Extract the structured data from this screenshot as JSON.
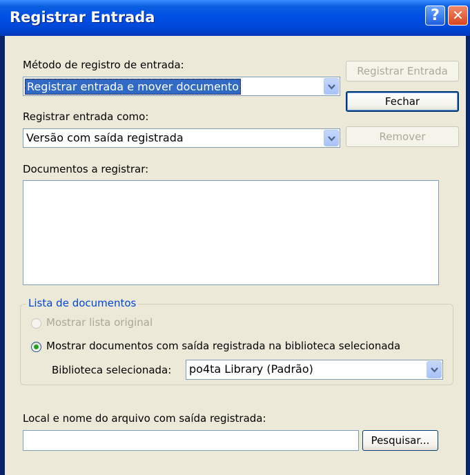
{
  "window": {
    "title": "Registrar Entrada",
    "help_label": "?",
    "close_label": "✕"
  },
  "method": {
    "label": "Método de registro de entrada:",
    "value": "Registrar entrada e mover documento"
  },
  "checkin_as": {
    "label": "Registrar entrada como:",
    "value": "Versão com saída registrada"
  },
  "documents": {
    "label": "Documentos a registrar:"
  },
  "buttons": {
    "checkin": "Registrar Entrada",
    "close": "Fechar",
    "remove": "Remover"
  },
  "doc_list": {
    "legend": "Lista de documentos",
    "option_original": "Mostrar lista original",
    "option_library": "Mostrar documentos com saída registrada na biblioteca selecionada",
    "library_label": "Biblioteca selecionada:",
    "library_value": "po4ta Library  (Padrão)"
  },
  "file": {
    "label": "Local e nome do arquivo com saída registrada:",
    "value": "",
    "browse": "Pesquisar..."
  },
  "icons": [
    "help-icon",
    "close-icon",
    "chevron-down-icon",
    "radio-selected-icon"
  ],
  "colors": {
    "titlebar": "#0050e6",
    "dialog_bg": "#ece9d8",
    "group_legend": "#0046d5",
    "selection": "#316ac5"
  }
}
